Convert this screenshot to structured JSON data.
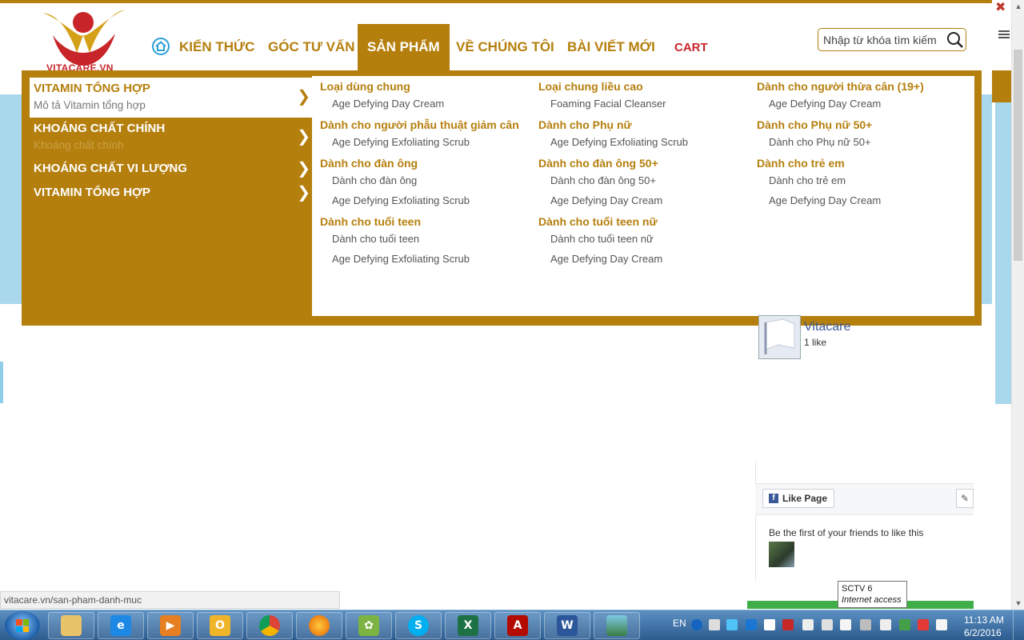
{
  "header": {
    "logo_text": "VITACARE.VN",
    "nav": [
      {
        "label": "KIẾN THỨC"
      },
      {
        "label": "GÓC TƯ VẤN"
      },
      {
        "label": "SẢN PHẨM"
      },
      {
        "label": "VỀ CHÚNG TÔI"
      },
      {
        "label": "BÀI VIẾT MỚI"
      },
      {
        "label": "CART"
      }
    ],
    "search": {
      "placeholder": "Nhập từ khóa tìm kiếm"
    }
  },
  "mega_menu": {
    "categories": [
      {
        "title": "VITAMIN TỔNG HỢP",
        "desc": "Mô tả Vitamin tổng hợp",
        "arrow": "❯"
      },
      {
        "title": "KHOÁNG CHẤT CHÍNH",
        "desc": "Khoáng chất chính",
        "arrow": "❯"
      },
      {
        "title": "KHOÁNG CHẤT VI LƯỢNG",
        "desc": "",
        "arrow": "❯"
      },
      {
        "title": "VITAMIN TỔNG HỢP",
        "desc": "",
        "arrow": "❯"
      }
    ],
    "columns": [
      {
        "groups": [
          {
            "title": "Loại dùng chung",
            "items": [
              "Age Defying Day Cream"
            ]
          },
          {
            "title": "Dành cho người phẫu thuật giảm cân",
            "items": [
              "Age Defying Exfoliating Scrub"
            ]
          },
          {
            "title": "Dành cho đàn ông",
            "items": [
              "Dành cho đàn ông",
              "Age Defying Exfoliating Scrub"
            ]
          },
          {
            "title": "Dành cho tuổi teen",
            "items": [
              "Dành cho tuổi teen",
              "Age Defying Exfoliating Scrub"
            ]
          }
        ]
      },
      {
        "groups": [
          {
            "title": "Loại chung liều cao",
            "items": [
              "Foaming Facial Cleanser"
            ]
          },
          {
            "title": "Dành cho Phụ nữ",
            "items": [
              "Age Defying Exfoliating Scrub"
            ]
          },
          {
            "title": "Dành cho đàn ông 50+",
            "items": [
              "Dành cho đàn ông 50+",
              "Age Defying Day Cream"
            ]
          },
          {
            "title": "Dành cho tuổi teen nữ",
            "items": [
              "Dành cho tuổi teen nữ",
              "Age Defying Day Cream"
            ]
          }
        ]
      },
      {
        "groups": [
          {
            "title": "Dành cho người thừa cân (19+)",
            "items": [
              "Age Defying Day Cream"
            ]
          },
          {
            "title": "Dành cho Phụ nữ 50+",
            "items": [
              "Dành cho Phụ nữ 50+"
            ]
          },
          {
            "title": "Dành cho trẻ em",
            "items": [
              "Dành cho trẻ em",
              "Age Defying Day Cream"
            ]
          }
        ]
      }
    ]
  },
  "facebook": {
    "page_name": "Vitacare",
    "likes": "1 like",
    "like_button": "Like Page",
    "friends_text": "Be the first of your friends to like this"
  },
  "browser": {
    "status_url": "vitacare.vn/san-pham-danh-muc",
    "tooltip_title": "SCTV  6",
    "tooltip_sub": "Internet access"
  },
  "taskbar": {
    "lang": "EN",
    "time": "11:13 AM",
    "date": "6/2/2016",
    "apps": [
      "explorer",
      "internet-explorer",
      "media-player",
      "outlook",
      "chrome",
      "firefox",
      "pidgin",
      "skype",
      "excel",
      "acrobat",
      "word",
      "photo-viewer"
    ]
  },
  "colors": {
    "brand": "#b57f0d",
    "accent_red": "#c8252a",
    "sky": "#a9d8ec"
  }
}
